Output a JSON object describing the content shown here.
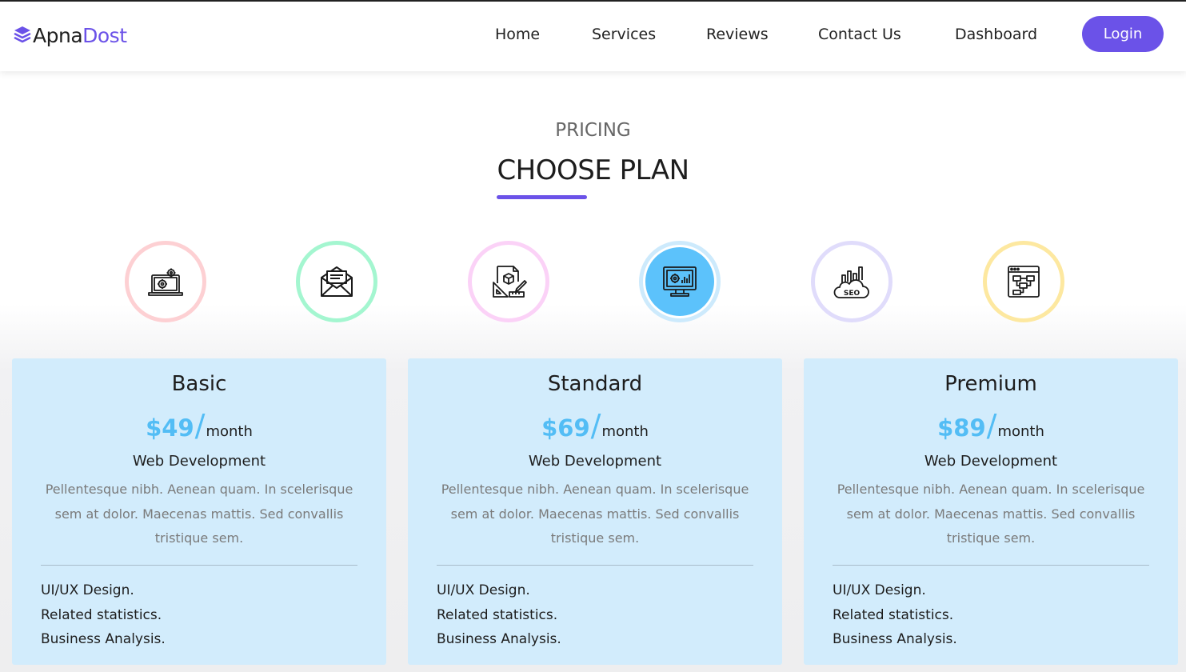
{
  "brand": {
    "name_part1": "Apna",
    "name_part2": "Dost",
    "icon": "layers-icon",
    "color": "#6b52e8"
  },
  "nav": {
    "links": [
      {
        "label": "Home"
      },
      {
        "label": "Services"
      },
      {
        "label": "Reviews"
      },
      {
        "label": "Contact Us"
      },
      {
        "label": "Dashboard"
      }
    ],
    "login_label": "Login"
  },
  "pricing": {
    "eyebrow": "PRICING",
    "title": "CHOOSE PLAN"
  },
  "services": [
    {
      "icon": "laptop-settings-icon",
      "ring_color": "#fdd0d3",
      "active": false
    },
    {
      "icon": "envelope-icon",
      "ring_color": "#a4f6d0",
      "active": false
    },
    {
      "icon": "design-tools-icon",
      "ring_color": "#fbd2f7",
      "active": false
    },
    {
      "icon": "monitor-analytics-icon",
      "ring_color": "#cdeafc",
      "active": true
    },
    {
      "icon": "seo-cloud-icon",
      "ring_color": "#e0dcfb",
      "active": false
    },
    {
      "icon": "workflow-browser-icon",
      "ring_color": "#fde8a0",
      "active": false
    }
  ],
  "plans": [
    {
      "name": "Basic",
      "price": "$49",
      "slash": "/",
      "period": "month",
      "subtitle": "Web Development",
      "description": "Pellentesque nibh. Aenean quam. In scelerisque sem at dolor. Maecenas mattis. Sed convallis tristique sem.",
      "features": [
        "UI/UX Design.",
        "Related statistics.",
        "Business Analysis."
      ]
    },
    {
      "name": "Standard",
      "price": "$69",
      "slash": "/",
      "period": "month",
      "subtitle": "Web Development",
      "description": "Pellentesque nibh. Aenean quam. In scelerisque sem at dolor. Maecenas mattis. Sed convallis tristique sem.",
      "features": [
        "UI/UX Design.",
        "Related statistics.",
        "Business Analysis."
      ]
    },
    {
      "name": "Premium",
      "price": "$89",
      "slash": "/",
      "period": "month",
      "subtitle": "Web Development",
      "description": "Pellentesque nibh. Aenean quam. In scelerisque sem at dolor. Maecenas mattis. Sed convallis tristique sem.",
      "features": [
        "UI/UX Design.",
        "Related statistics.",
        "Business Analysis."
      ]
    }
  ],
  "colors": {
    "accent": "#6b52e8",
    "price": "#53bdf5",
    "card_bg": "#d2ecfc",
    "active_icon_bg": "#5cc2fb"
  }
}
